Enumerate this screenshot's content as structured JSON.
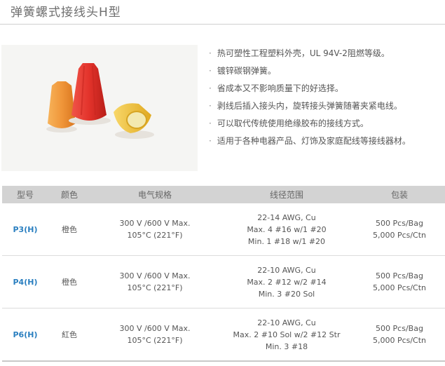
{
  "page": {
    "title": "弹簧螺式接线头H型"
  },
  "features": [
    "热可塑性工程塑料外壳，UL 94V-2阻燃等级。",
    "镀锌碳钢弹簧。",
    "省成本又不影响质量下的好选择。",
    "剥线后插入接头内，旋转接头弹簧随著夹紧电线。",
    "可以取代传统使用绝缘胶布的接线方式。",
    "适用于各种电器产品、灯饰及家庭配线等接线器材。"
  ],
  "bullet": "·",
  "table": {
    "headers": [
      "型号",
      "颜色",
      "电气规格",
      "线径范围",
      "包装"
    ],
    "rows": [
      {
        "model": "P3(H)",
        "color": "橙色",
        "elec": [
          "300 V /600 V Max.",
          "105°C (221°F)"
        ],
        "range": [
          "22-14 AWG, Cu",
          "Max. 4 #16 w/1 #20",
          "Min. 1 #18 w/1 #20"
        ],
        "pack": [
          "500 Pcs/Bag",
          "5,000 Pcs/Ctn"
        ]
      },
      {
        "model": "P4(H)",
        "color": "橙色",
        "elec": [
          "300 V /600 V Max.",
          "105°C (221°F)"
        ],
        "range": [
          "22-10 AWG, Cu",
          "Max. 2 #12 w/2 #14",
          "Min. 3 #20 Sol"
        ],
        "pack": [
          "500 Pcs/Bag",
          "5,000 Pcs/Ctn"
        ]
      },
      {
        "model": "P6(H)",
        "color": "紅色",
        "elec": [
          "300 V /600 V Max.",
          "105°C (221°F)"
        ],
        "range": [
          "22-10 AWG, Cu",
          "Max. 2 #10 Sol w/2 #12 Str",
          "Min. 3 #18"
        ],
        "pack": [
          "500 Pcs/Bag",
          "5,000 Pcs/Ctn"
        ]
      }
    ]
  },
  "colors": {
    "orange": "#f0963a",
    "red": "#e3332b",
    "yellow": "#f2c33a",
    "model_link": "#2a7fc0",
    "header_bg": "#d3d3d3"
  }
}
